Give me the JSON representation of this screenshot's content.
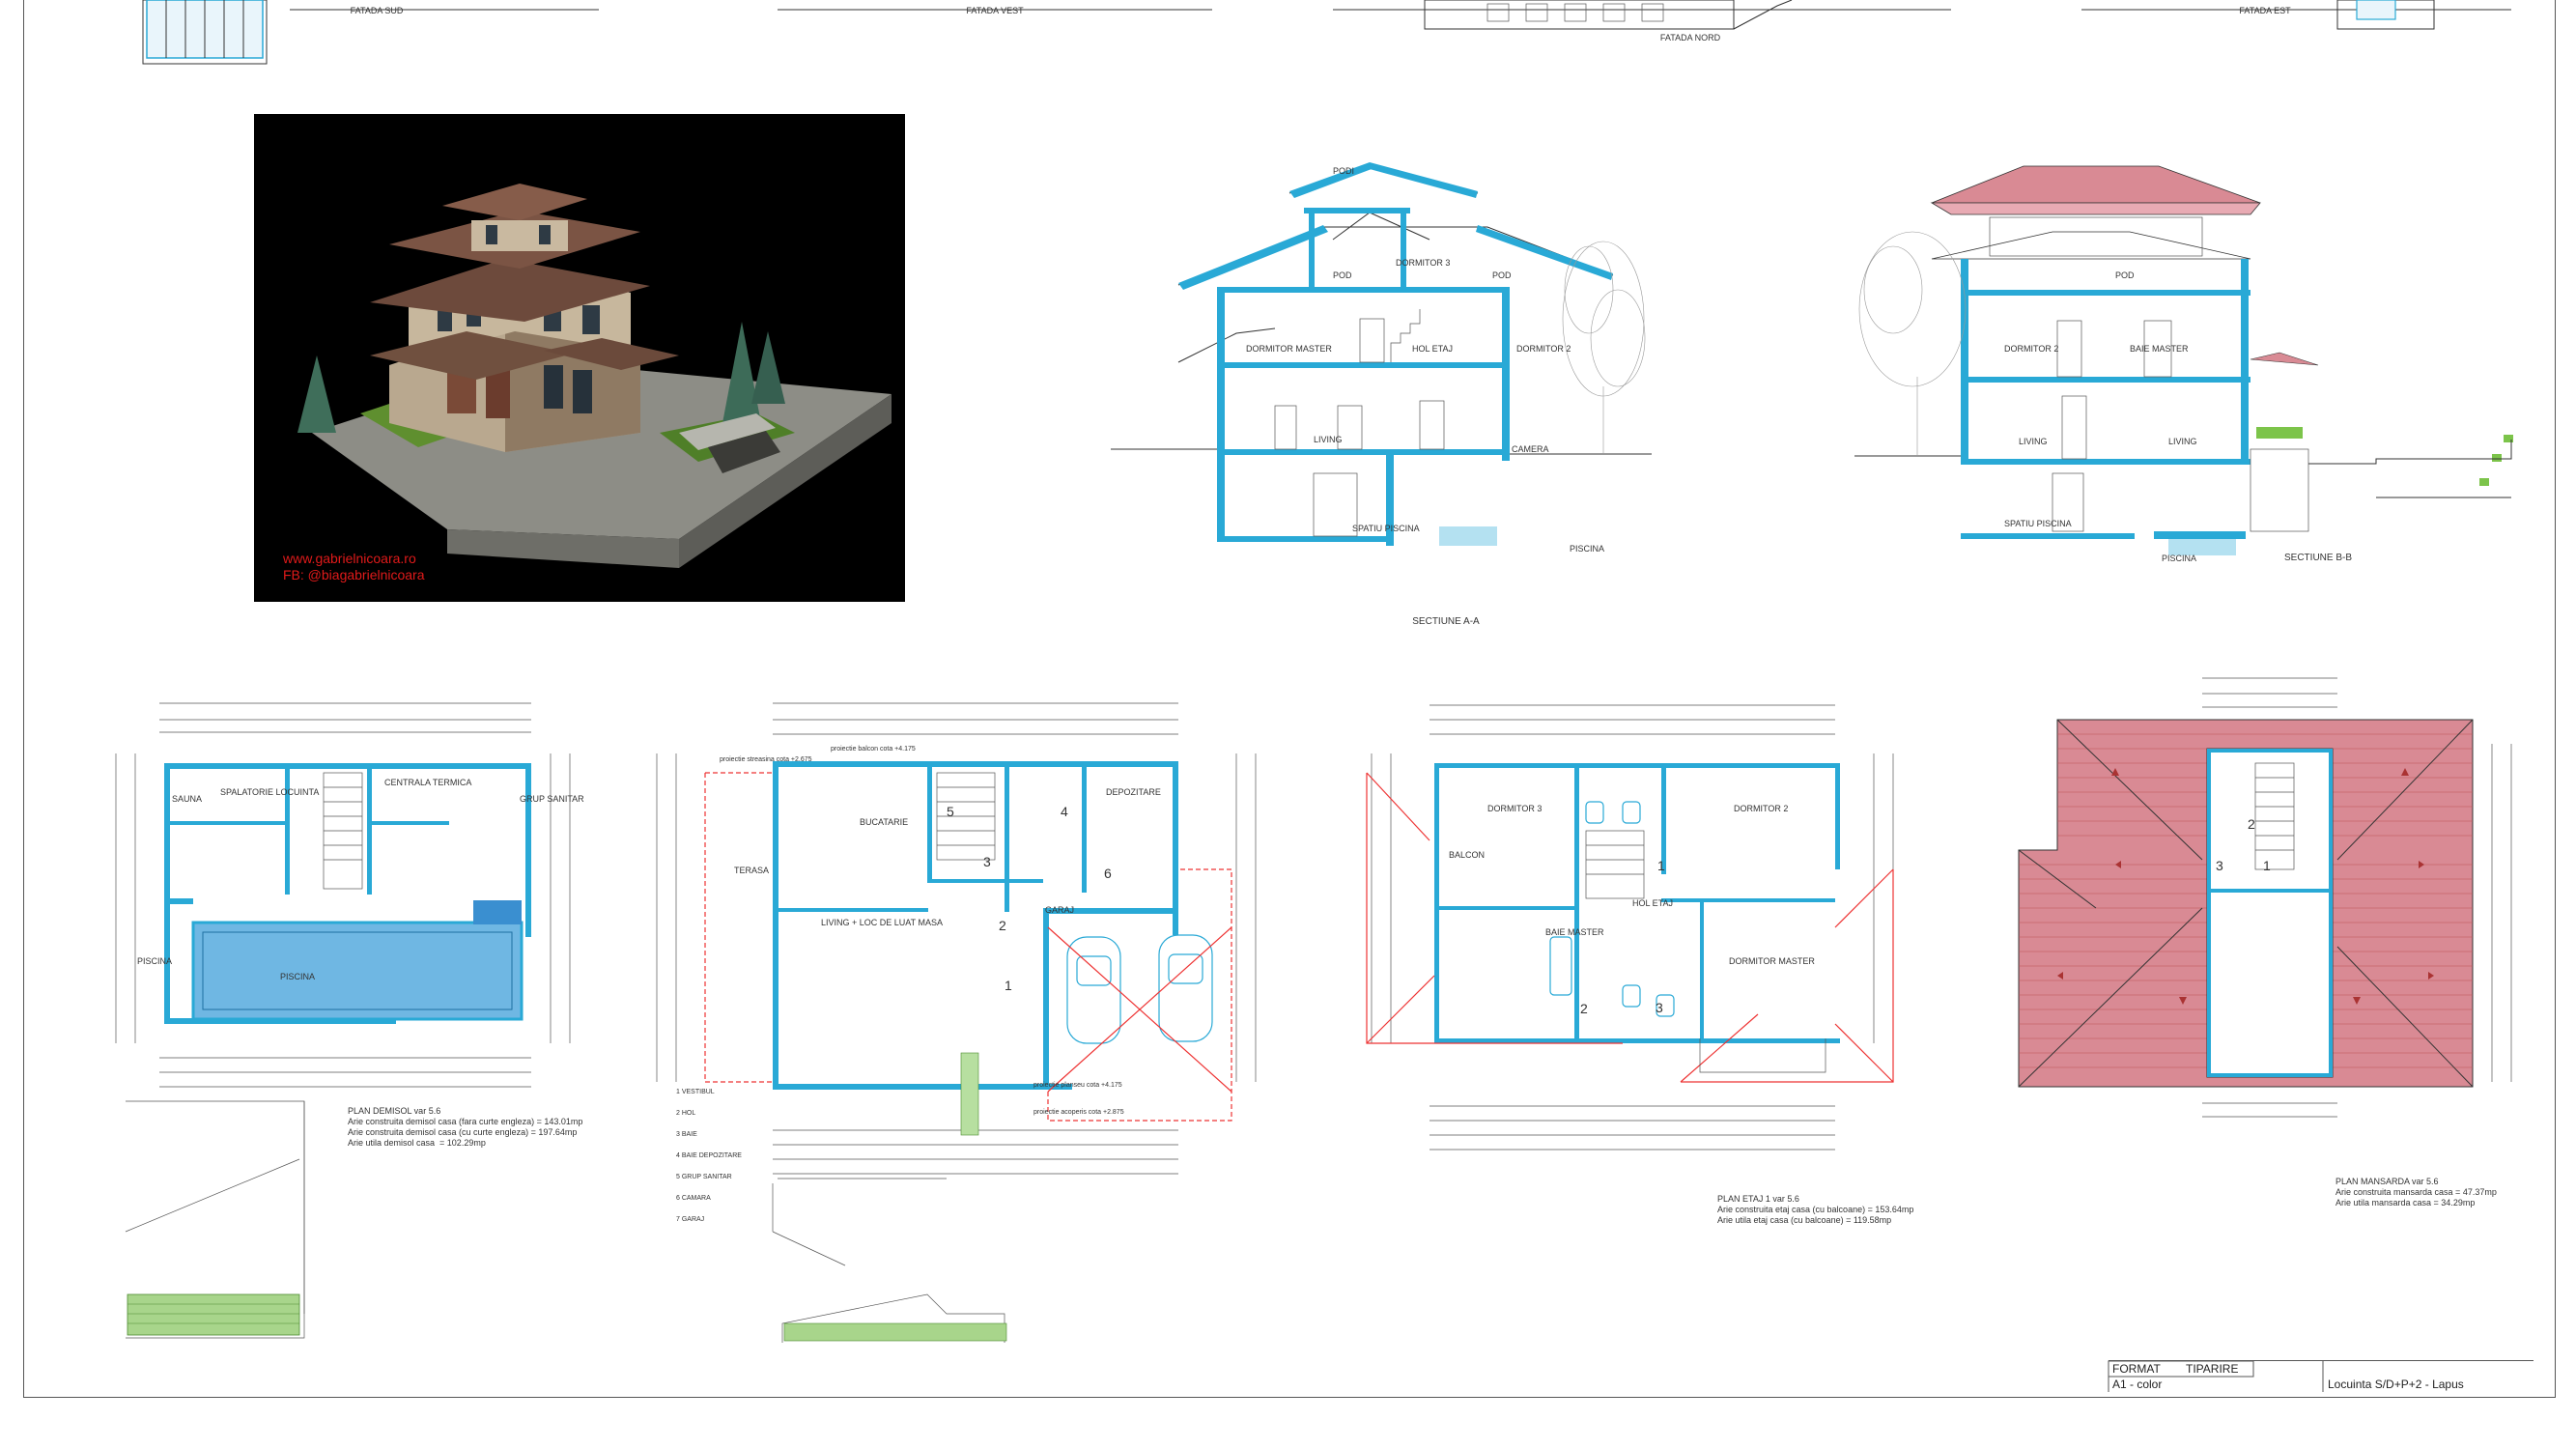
{
  "elevations": [
    {
      "label": "FATADA SUD"
    },
    {
      "label": "FATADA VEST"
    },
    {
      "label": "FATADA NORD"
    },
    {
      "label": "FATADA EST"
    }
  ],
  "render": {
    "url_line1": "www.gabrielnicoara.ro",
    "url_line2": "FB: @biagabrielnicoara"
  },
  "sections": {
    "a": {
      "title": "SECTIUNE A-A",
      "rooms": [
        "PODI",
        "DORMITOR 3",
        "POD",
        "POD",
        "DORMITOR MASTER",
        "HOL ETAJ",
        "DORMITOR 2",
        "LIVING",
        "CAMERA",
        "SPATIU PISCINA",
        "PISCINA"
      ]
    },
    "b": {
      "title": "SECTIUNE B-B",
      "rooms": [
        "POD",
        "DORMITOR 2",
        "BAIE MASTER",
        "LIVING",
        "LIVING",
        "SPATIU PISCINA",
        "PISCINA"
      ]
    }
  },
  "plans": {
    "demisol": {
      "title": "PLAN DEMISOL var 5.6",
      "line1": "Arie construita demisol casa (fara curte engleza) = 143.01mp",
      "line2": "Arie construita demisol casa (cu curte engleza) = 197.64mp",
      "line3": "Arie utila demisol casa  = 102.29mp",
      "rooms": [
        "SPALATORIE LOCUINTA",
        "CENTRALA TERMICA",
        "GRUP SANITAR",
        "PISCINA",
        "SAUNA",
        "PISCINA"
      ]
    },
    "parter": {
      "rooms": [
        "LIVING + LOC DE LUAT MASA",
        "BUCATARIE",
        "DEPOZITARE",
        "GARAJ",
        "TERASA"
      ],
      "numbers": [
        "5",
        "4",
        "3",
        "6",
        "2",
        "1"
      ],
      "notes": [
        "proiectie streasina cota +2.675",
        "proiectie balcon cota +4.175",
        "proiectie planseu cota +4.175",
        "proiectie acoperis cota +2.875"
      ]
    },
    "etaj": {
      "title": "PLAN ETAJ 1 var 5.6",
      "line1": "Arie construita etaj casa (cu balcoane) = 153.64mp",
      "line2": "Arie utila etaj casa (cu balcoane) = 119.58mp",
      "numbers": [
        "1",
        "2",
        "3"
      ],
      "rooms": [
        "DORMITOR 3",
        "DORMITOR 2",
        "DORMITOR MASTER",
        "BAIE MASTER",
        "HOL ETAJ",
        "BALCON"
      ]
    },
    "mansarda": {
      "title": "PLAN MANSARDA var 5.6",
      "line1": "Arie construita mansarda casa = 47.37mp",
      "line2": "Arie utila mansarda casa = 34.29mp",
      "numbers": [
        "2",
        "3",
        "1"
      ]
    }
  },
  "legend_left": [
    "1 VESTIBUL",
    "2 HOL",
    "3 BAIE",
    "4 BAIE DEPOZITARE",
    "5 GRUP SANITAR",
    "6 CAMARA",
    "7 GARAJ"
  ],
  "titleblock": {
    "format_label": "FORMAT",
    "print_label": "TIPARIRE",
    "format_value": "A1 - color",
    "project": "Locuinta S/D+P+2 - Lapus"
  },
  "colors": {
    "wall": "#29a9d6",
    "roof": "#d98a94",
    "render_text": "#e01a1a",
    "grass": "#8bc34a"
  }
}
